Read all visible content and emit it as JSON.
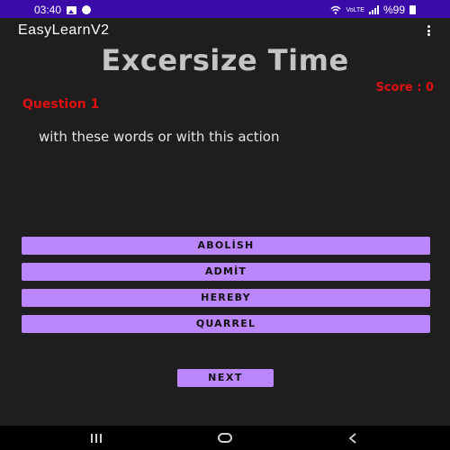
{
  "status_bar": {
    "time": "03:40",
    "network_label": "VoLTE",
    "battery": "%99",
    "icons": [
      "image-icon",
      "notification-circle-icon",
      "wifi-icon",
      "signal-icon",
      "battery-icon"
    ]
  },
  "app_bar": {
    "title": "EasyLearnV2",
    "menu_icon": "overflow-menu-icon"
  },
  "main": {
    "title": "Excersize Time",
    "score": "Score : 0",
    "question_label": "Question 1",
    "question_text": "with these words or with this action",
    "options": [
      "ABOLİSH",
      "ADMİT",
      "HEREBY",
      "QUARREL"
    ],
    "next_label": "NEXT"
  },
  "nav_bar": {
    "icons": [
      "recents-icon",
      "home-icon",
      "back-icon"
    ]
  },
  "colors": {
    "status_bar": "#3a0ba8",
    "background": "#1e1e1e",
    "accent_button": "#bb86fc",
    "score_red": "#e01010",
    "title_gray": "#c4c4c4"
  }
}
